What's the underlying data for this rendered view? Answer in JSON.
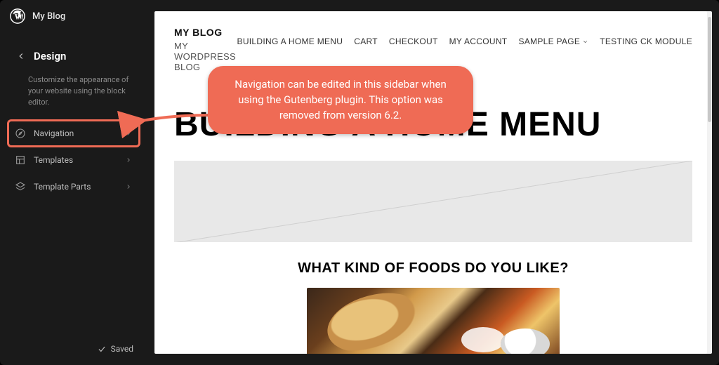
{
  "topbar": {
    "site_name": "My Blog"
  },
  "panel": {
    "title": "Design",
    "description": "Customize the appearance of your website using the block editor."
  },
  "sidebar_items": [
    {
      "label": "Navigation"
    },
    {
      "label": "Templates"
    },
    {
      "label": "Template Parts"
    }
  ],
  "footer": {
    "status": "Saved"
  },
  "preview": {
    "site_title": "MY BLOG",
    "tagline": "MY WORDPRESS BLOG",
    "menu": [
      {
        "label": "BUILDING A HOME MENU",
        "has_submenu": false
      },
      {
        "label": "CART",
        "has_submenu": false
      },
      {
        "label": "CHECKOUT",
        "has_submenu": false
      },
      {
        "label": "MY ACCOUNT",
        "has_submenu": false
      },
      {
        "label": "SAMPLE PAGE",
        "has_submenu": true
      },
      {
        "label": "TESTING CK MODULE",
        "has_submenu": false
      }
    ],
    "h1": "BUILDING A HOME MENU",
    "h2": "WHAT KIND OF FOODS DO YOU LIKE?"
  },
  "callout": {
    "text": "Navigation can be edited in this sidebar when using the Gutenberg plugin.  This option was removed from version 6.2."
  },
  "colors": {
    "accent": "#ef6b55"
  }
}
